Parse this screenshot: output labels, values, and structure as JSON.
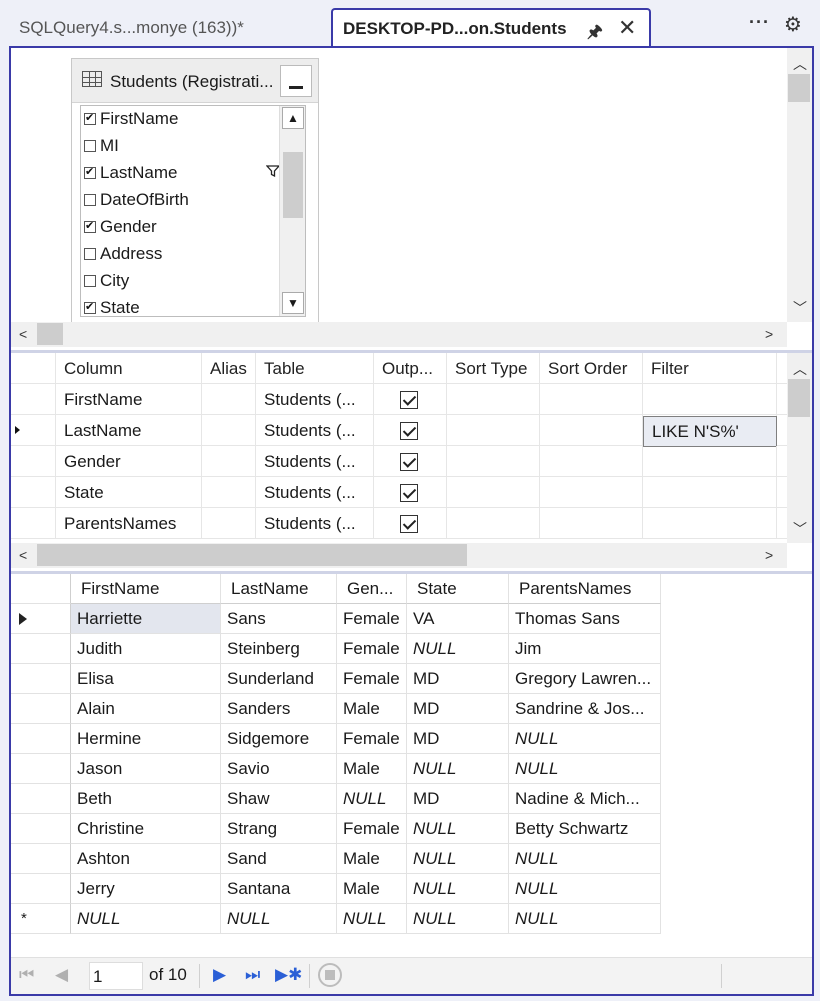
{
  "tabs": [
    {
      "label": "SQLQuery4.s...monye (163))*",
      "active": false
    },
    {
      "label": "DESKTOP-PD...on.Students",
      "active": true
    }
  ],
  "tab_icons": {
    "pin": "pin-icon",
    "close": "close-icon",
    "more": "more-options-icon",
    "settings": "gear-icon"
  },
  "diagram": {
    "table_title": "Students (Registrati...",
    "columns": [
      {
        "name": "FirstName",
        "checked": true
      },
      {
        "name": "MI",
        "checked": false
      },
      {
        "name": "LastName",
        "checked": true,
        "filtered": true
      },
      {
        "name": "DateOfBirth",
        "checked": false
      },
      {
        "name": "Gender",
        "checked": true
      },
      {
        "name": "Address",
        "checked": false
      },
      {
        "name": "City",
        "checked": false
      },
      {
        "name": "State",
        "checked": true
      }
    ]
  },
  "criteria": {
    "headers": [
      "Column",
      "Alias",
      "Table",
      "Outp...",
      "Sort Type",
      "Sort Order",
      "Filter"
    ],
    "rows": [
      {
        "column": "FirstName",
        "alias": "",
        "table": "Students (...",
        "output": true,
        "sort_type": "",
        "sort_order": "",
        "filter": ""
      },
      {
        "column": "LastName",
        "alias": "",
        "table": "Students (...",
        "output": true,
        "sort_type": "",
        "sort_order": "",
        "filter": "LIKE N'S%'"
      },
      {
        "column": "Gender",
        "alias": "",
        "table": "Students (...",
        "output": true,
        "sort_type": "",
        "sort_order": "",
        "filter": ""
      },
      {
        "column": "State",
        "alias": "",
        "table": "Students (...",
        "output": true,
        "sort_type": "",
        "sort_order": "",
        "filter": ""
      },
      {
        "column": "ParentsNames",
        "alias": "",
        "table": "Students (...",
        "output": true,
        "sort_type": "",
        "sort_order": "",
        "filter": ""
      }
    ]
  },
  "results": {
    "headers": [
      "FirstName",
      "LastName",
      "Gen...",
      "State",
      "ParentsNames"
    ],
    "rows": [
      [
        "Harriette",
        "Sans",
        "Female",
        "VA",
        "Thomas Sans"
      ],
      [
        "Judith",
        "Steinberg",
        "Female",
        "NULL",
        "Jim"
      ],
      [
        "Elisa",
        "Sunderland",
        "Female",
        "MD",
        "Gregory Lawren..."
      ],
      [
        "Alain",
        "Sanders",
        "Male",
        "MD",
        "Sandrine & Jos..."
      ],
      [
        "Hermine",
        "Sidgemore",
        "Female",
        "MD",
        "NULL"
      ],
      [
        "Jason",
        "Savio",
        "Male",
        "NULL",
        "NULL"
      ],
      [
        "Beth",
        "Shaw",
        "NULL",
        "MD",
        "Nadine & Mich..."
      ],
      [
        "Christine",
        "Strang",
        "Female",
        "NULL",
        "Betty Schwartz"
      ],
      [
        "Ashton",
        "Sand",
        "Male",
        "NULL",
        "NULL"
      ],
      [
        "Jerry",
        "Santana",
        "Male",
        "NULL",
        "NULL"
      ],
      [
        "NULL",
        "NULL",
        "NULL",
        "NULL",
        "NULL"
      ]
    ]
  },
  "navigation": {
    "current_page": "1",
    "page_total_label": "of 10"
  }
}
